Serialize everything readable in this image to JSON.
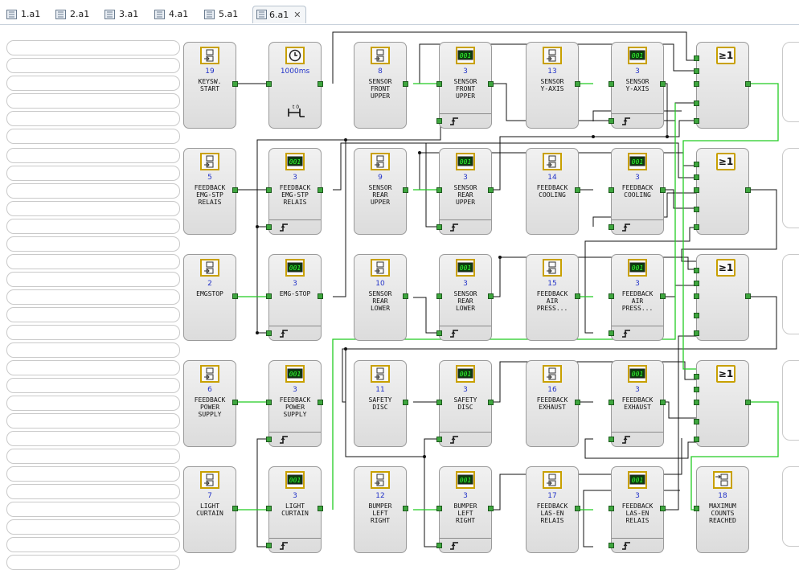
{
  "tabs": [
    {
      "label": "1.a1",
      "active": false
    },
    {
      "label": "2.a1",
      "active": false
    },
    {
      "label": "3.a1",
      "active": false
    },
    {
      "label": "4.a1",
      "active": false
    },
    {
      "label": "5.a1",
      "active": false
    },
    {
      "label": "6.a1",
      "active": true
    }
  ],
  "tab_close_glyph": "✕",
  "blocks": {
    "b19": {
      "num": "19",
      "label": "KEYSW.\nSTART",
      "icon": "digital-input-icon"
    },
    "tmr": {
      "num": "1000ms",
      "label": "",
      "icon": "clock-icon"
    },
    "b8": {
      "num": "8",
      "label": "SENSOR\nFRONT\nUPPER",
      "icon": "digital-input-icon"
    },
    "c1": {
      "num": "3",
      "label": "SENSOR\nFRONT\nUPPER",
      "icon": "counter-icon"
    },
    "b13": {
      "num": "13",
      "label": "SENSOR\nY-AXIS",
      "icon": "digital-input-icon"
    },
    "c2": {
      "num": "3",
      "label": "SENSOR\nY-AXIS",
      "icon": "counter-icon"
    },
    "b5": {
      "num": "5",
      "label": "FEEDBACK\nEMG-STP\nRELAIS",
      "icon": "digital-input-icon"
    },
    "c3": {
      "num": "3",
      "label": "FEEDBACK\nEMG-STP\nRELAIS",
      "icon": "counter-icon"
    },
    "b9": {
      "num": "9",
      "label": "SENSOR\nREAR\nUPPER",
      "icon": "digital-input-icon"
    },
    "c4": {
      "num": "3",
      "label": "SENSOR\nREAR\nUPPER",
      "icon": "counter-icon"
    },
    "b14": {
      "num": "14",
      "label": "FEEDBACK\nCOOLING",
      "icon": "digital-input-icon"
    },
    "c5": {
      "num": "3",
      "label": "FEEDBACK\nCOOLING",
      "icon": "counter-icon"
    },
    "b2": {
      "num": "2",
      "label": "EMGSTOP",
      "icon": "digital-input-icon"
    },
    "c6": {
      "num": "3",
      "label": "EMG-STOP",
      "icon": "counter-icon"
    },
    "b10": {
      "num": "10",
      "label": "SENSOR\nREAR\nLOWER",
      "icon": "digital-input-icon"
    },
    "c7": {
      "num": "3",
      "label": "SENSOR\nREAR\nLOWER",
      "icon": "counter-icon"
    },
    "b15": {
      "num": "15",
      "label": "FEEDBACK\nAIR\nPRESS...",
      "icon": "digital-input-icon"
    },
    "c8": {
      "num": "3",
      "label": "FEEDBACK\nAIR\nPRESS...",
      "icon": "counter-icon"
    },
    "b6": {
      "num": "6",
      "label": "FEEDBACK\nPOWER\nSUPPLY",
      "icon": "digital-input-icon"
    },
    "c9": {
      "num": "3",
      "label": "FEEDBACK\nPOWER\nSUPPLY",
      "icon": "counter-icon"
    },
    "b11": {
      "num": "11",
      "label": "SAFETY\nDISC",
      "icon": "digital-input-icon"
    },
    "c10": {
      "num": "3",
      "label": "SAFETY\nDISC",
      "icon": "counter-icon"
    },
    "b16": {
      "num": "16",
      "label": "FEEDBACK\nEXHAUST",
      "icon": "digital-input-icon"
    },
    "c11": {
      "num": "3",
      "label": "FEEDBACK\nEXHAUST",
      "icon": "counter-icon"
    },
    "b7": {
      "num": "7",
      "label": "LIGHT\nCURTAIN",
      "icon": "digital-input-icon"
    },
    "c12": {
      "num": "3",
      "label": "LIGHT\nCURTAIN",
      "icon": "counter-icon"
    },
    "b12": {
      "num": "12",
      "label": "BUMPER\nLEFT\nRIGHT",
      "icon": "digital-input-icon"
    },
    "c13": {
      "num": "3",
      "label": "BUMPER\nLEFT\nRIGHT",
      "icon": "counter-icon"
    },
    "b17": {
      "num": "17",
      "label": "FEEDBACK\nLAS-EN\nRELAIS",
      "icon": "digital-input-icon"
    },
    "c14": {
      "num": "3",
      "label": "FEEDBACK\nLAS-EN\nRELAIS",
      "icon": "counter-icon"
    },
    "b18": {
      "num": "18",
      "label": "MAXIMUM\nCOUNTS\nREACHED",
      "icon": "digital-output-icon"
    }
  },
  "or_gates": [
    {
      "symbol": "≥1"
    },
    {
      "symbol": "≥1"
    },
    {
      "symbol": "≥1"
    },
    {
      "symbol": "≥1"
    }
  ],
  "counter_display": "001",
  "timer_glyph": "t  0",
  "colors": {
    "signal_active": "#22cc22",
    "signal_idle": "#111111",
    "port": "#3ea63e",
    "counter_screen": "#0d3d0d",
    "counter_digits": "#33ff33",
    "icon_frame": "#c8a000",
    "number": "#2232c8"
  }
}
